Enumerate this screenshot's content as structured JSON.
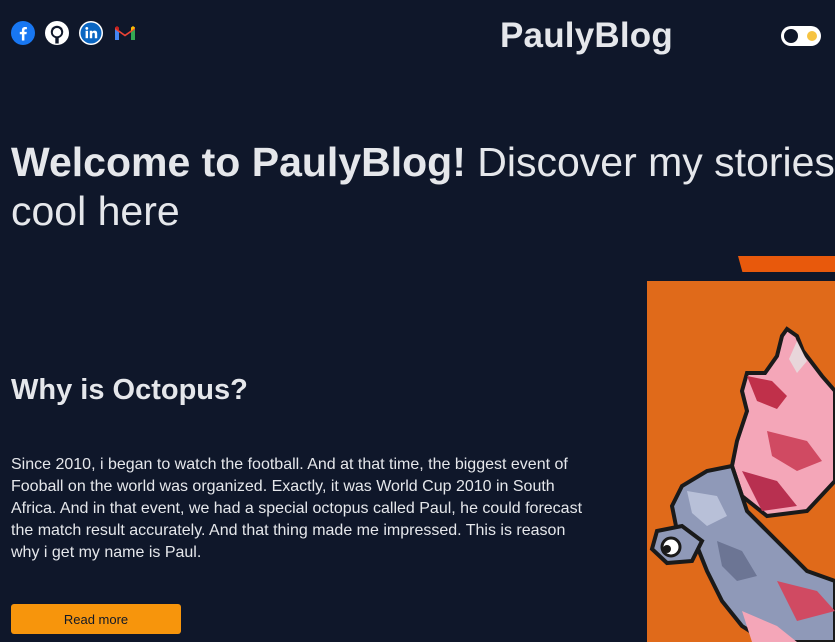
{
  "header": {
    "brand": "PaulyBlog",
    "social_icons": [
      "facebook-icon",
      "github-icon",
      "linkedin-icon",
      "gmail-icon"
    ],
    "theme_toggle": "dark"
  },
  "hero": {
    "bold": "Welcome to PaulyBlog!",
    "rest": " Discover my stories cool here"
  },
  "post": {
    "title": "Why is Octopus?",
    "body": "Since 2010, i began to watch the football. And at that time, the biggest event of Fooball on the world was organized. Exactly, it was World Cup 2010 in South Africa. And in that event, we had a special octopus called Paul, he could forecast the match result accurately. And that thing made me impressed. This is reason why i get my name is Paul.",
    "button": "Read more"
  },
  "colors": {
    "background": "#0f172a",
    "accent": "#f7950c",
    "art_background": "#e06a1a"
  }
}
